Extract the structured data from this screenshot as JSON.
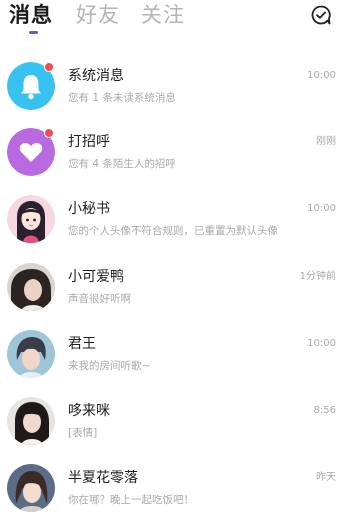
{
  "tabs": [
    {
      "label": "消息"
    },
    {
      "label": "好友"
    },
    {
      "label": "关注"
    }
  ],
  "colors": {
    "accent": "#5b5fe0",
    "badge": "#f24d4d",
    "bell_bg": "#38c2f2",
    "heart_bg": "#b96ae0"
  },
  "top_right_icon": "chat-check-icon",
  "messages": [
    {
      "name": "系统消息",
      "preview": "您有 1 条未读系统消息",
      "time": "10:00",
      "avatar": "bell-icon",
      "unread": true
    },
    {
      "name": "打招呼",
      "preview": "您有 4 条陌生人的招呼",
      "time": "刚刚",
      "avatar": "heart-icon",
      "unread": true
    },
    {
      "name": "小秘书",
      "preview": "您的个人头像不符合规则，已重置为默认头像",
      "time": "10:00",
      "avatar": "cartoon-girl-avatar",
      "unread": false
    },
    {
      "name": "小可爱鸭",
      "preview": "声音很好听啊",
      "time": "1分钟前",
      "avatar": "user-avatar",
      "unread": false
    },
    {
      "name": "君王",
      "preview": "来我的房间听歌~",
      "time": "10:00",
      "avatar": "user-avatar",
      "unread": false
    },
    {
      "name": "哆来咪",
      "preview": "[表情]",
      "time": "8:56",
      "avatar": "user-avatar",
      "unread": false
    },
    {
      "name": "半夏花零落",
      "preview": "你在哪？晚上一起吃饭吧！",
      "time": "昨天",
      "avatar": "user-avatar",
      "unread": false
    }
  ]
}
